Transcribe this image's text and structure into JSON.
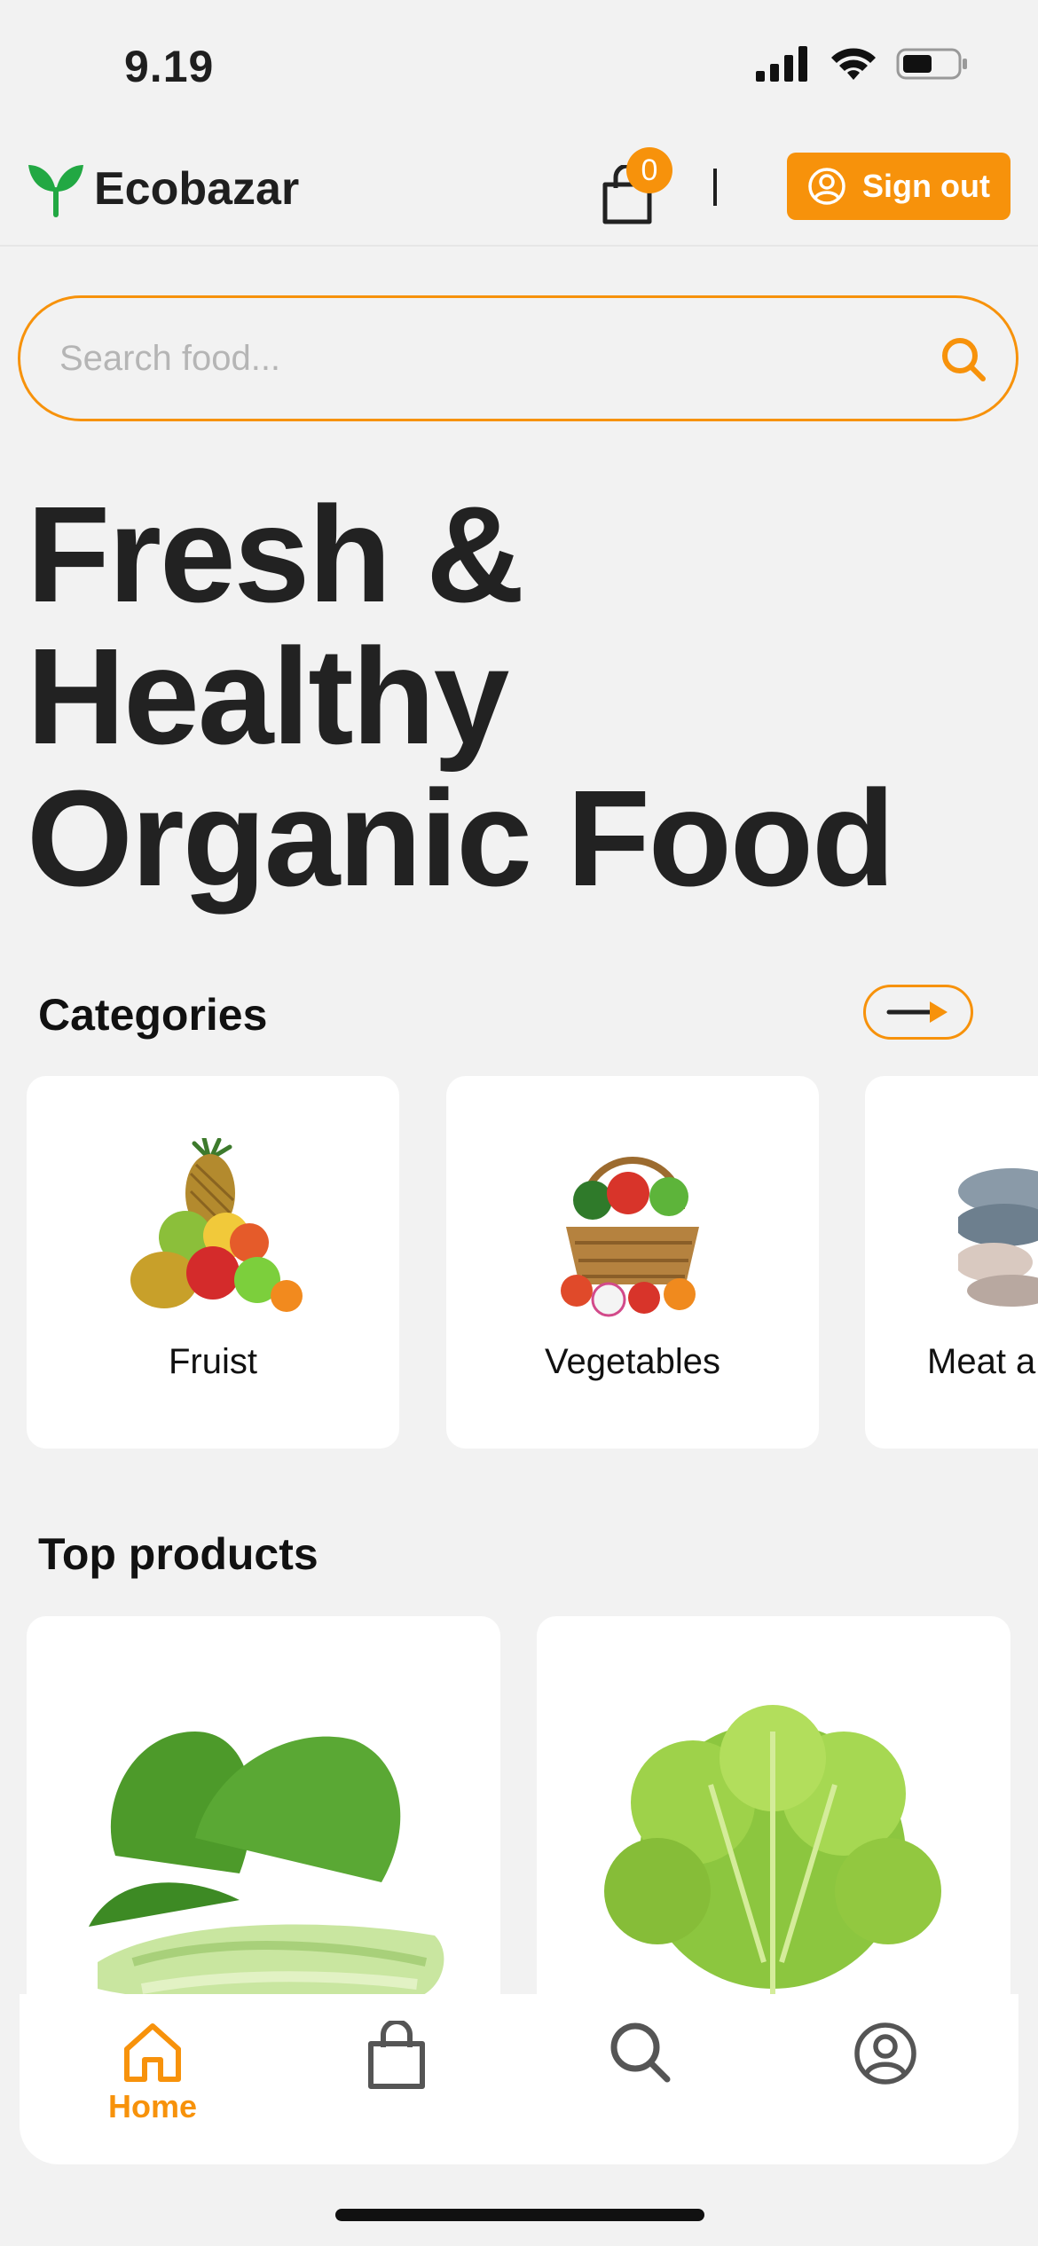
{
  "status": {
    "time": "9.19"
  },
  "header": {
    "brand": "Ecobazar",
    "cart_count": "0",
    "signout_label": "Sign out"
  },
  "search": {
    "placeholder": "Search food..."
  },
  "hero": {
    "line1": "Fresh &",
    "line2": "Healthy",
    "line3": "Organic Food"
  },
  "categories": {
    "title": "Categories",
    "items": [
      {
        "label": "Fruist"
      },
      {
        "label": "Vegetables"
      },
      {
        "label": "Meat a"
      }
    ]
  },
  "top_products": {
    "title": "Top products"
  },
  "bottom_nav": {
    "items": [
      {
        "label": "Home",
        "icon": "home-icon",
        "active": true
      },
      {
        "label": "",
        "icon": "bag-icon",
        "active": false
      },
      {
        "label": "",
        "icon": "search-icon",
        "active": false
      },
      {
        "label": "",
        "icon": "profile-icon",
        "active": false
      }
    ]
  },
  "colors": {
    "accent": "#f7920b",
    "background": "#f2f2f2",
    "text": "#1f1f1f",
    "brand_leaf": "#22a843"
  }
}
